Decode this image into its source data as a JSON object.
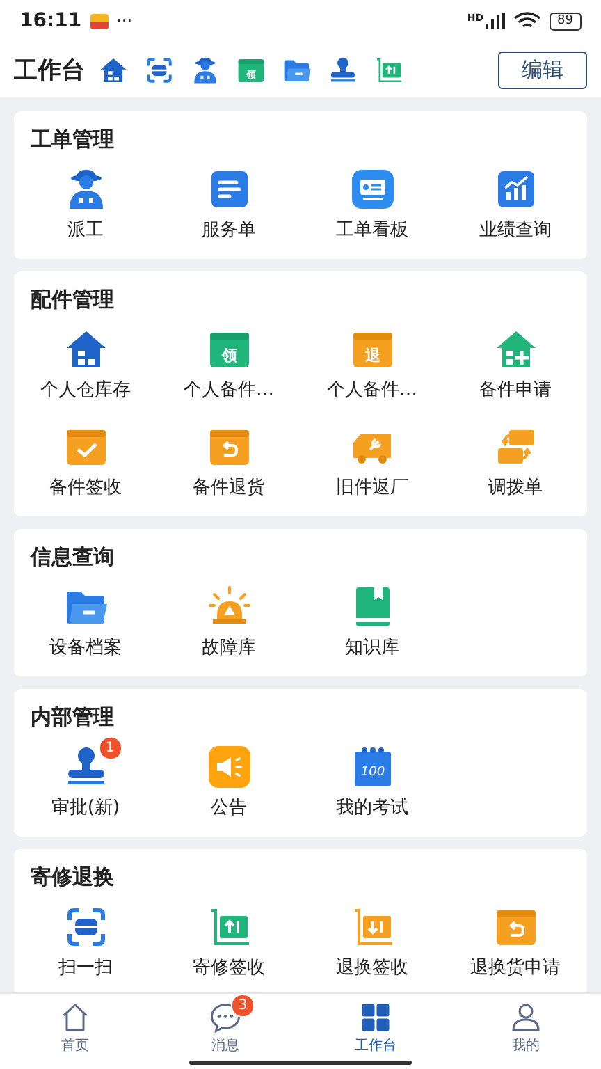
{
  "status_bar": {
    "time": "16:11",
    "more": "···",
    "network": "HD",
    "battery": "89"
  },
  "header": {
    "title": "工作台",
    "shortcuts": [
      {
        "kind": "house"
      },
      {
        "kind": "scan"
      },
      {
        "kind": "worker"
      },
      {
        "kind": "box-green",
        "glyph": "领"
      },
      {
        "kind": "folder"
      },
      {
        "kind": "stamp"
      },
      {
        "kind": "cart-up"
      }
    ],
    "edit_button": "编辑"
  },
  "sections": [
    {
      "title": "工单管理",
      "items": [
        {
          "label": "派工",
          "kind": "worker"
        },
        {
          "label": "服务单",
          "kind": "doc"
        },
        {
          "label": "工单看板",
          "kind": "board"
        },
        {
          "label": "业绩查询",
          "kind": "chart"
        }
      ]
    },
    {
      "title": "配件管理",
      "items": [
        {
          "label": "个人仓库存",
          "kind": "house"
        },
        {
          "label": "个人备件…",
          "kind": "box-green",
          "glyph": "领"
        },
        {
          "label": "个人备件…",
          "kind": "box-orange",
          "glyph": "退"
        },
        {
          "label": "备件申请",
          "kind": "house-plus"
        },
        {
          "label": "备件签收",
          "kind": "box-check"
        },
        {
          "label": "备件退货",
          "kind": "box-return"
        },
        {
          "label": "旧件返厂",
          "kind": "truck"
        },
        {
          "label": "调拨单",
          "kind": "swap"
        }
      ]
    },
    {
      "title": "信息查询",
      "items": [
        {
          "label": "设备档案",
          "kind": "folder"
        },
        {
          "label": "故障库",
          "kind": "alarm"
        },
        {
          "label": "知识库",
          "kind": "book"
        }
      ]
    },
    {
      "title": "内部管理",
      "items": [
        {
          "label": "审批(新)",
          "kind": "stamp",
          "badge": "1"
        },
        {
          "label": "公告",
          "kind": "megaphone"
        },
        {
          "label": "我的考试",
          "kind": "calendar",
          "glyph": "100"
        }
      ]
    },
    {
      "title": "寄修退换",
      "items": [
        {
          "label": "扫一扫",
          "kind": "scan"
        },
        {
          "label": "寄修签收",
          "kind": "cart-up"
        },
        {
          "label": "退换签收",
          "kind": "cart-down"
        },
        {
          "label": "退换货申请",
          "kind": "box-return"
        }
      ]
    }
  ],
  "tab_bar": [
    {
      "label": "首页",
      "kind": "home",
      "selected": false
    },
    {
      "label": "消息",
      "kind": "chat",
      "selected": false,
      "badge": "3"
    },
    {
      "label": "工作台",
      "kind": "grid",
      "selected": true
    },
    {
      "label": "我的",
      "kind": "user",
      "selected": false
    }
  ]
}
